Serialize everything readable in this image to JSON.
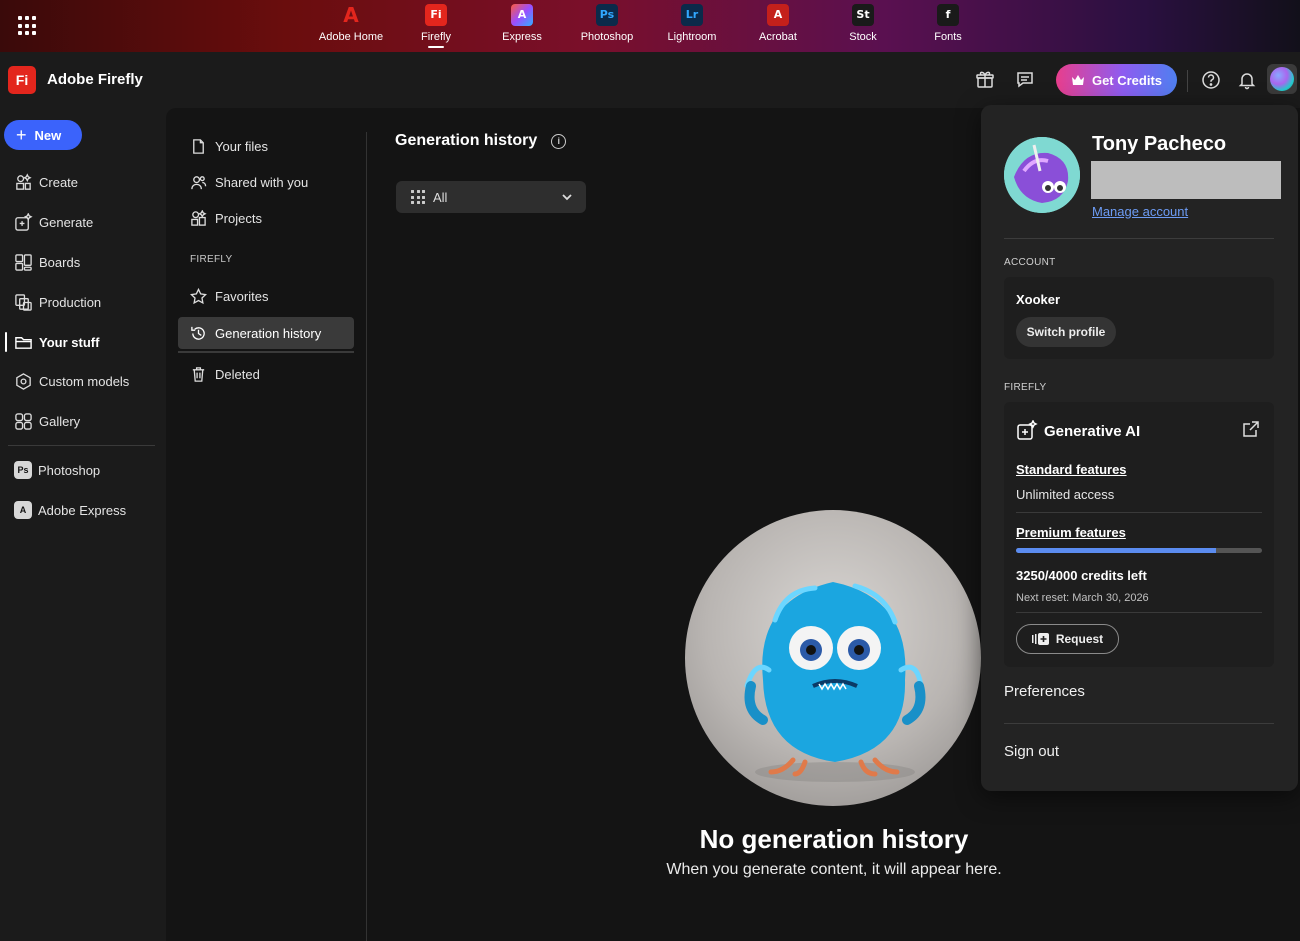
{
  "topbar": {
    "apps": [
      {
        "label": "Adobe Home",
        "icon": "adobe-logo-icon",
        "glyph": "A",
        "color": "#e3261d"
      },
      {
        "label": "Firefly",
        "icon": "firefly-icon",
        "glyph": "Fi",
        "color": "#e3261d"
      },
      {
        "label": "Express",
        "icon": "express-icon",
        "glyph": "A",
        "color": "#1a1a3a"
      },
      {
        "label": "Photoshop",
        "icon": "photoshop-icon",
        "glyph": "Ps",
        "color": "#0b2a4a"
      },
      {
        "label": "Lightroom",
        "icon": "lightroom-icon",
        "glyph": "Lr",
        "color": "#0b2a4a"
      },
      {
        "label": "Acrobat",
        "icon": "acrobat-icon",
        "glyph": "A",
        "color": "#c4201b"
      },
      {
        "label": "Stock",
        "icon": "stock-icon",
        "glyph": "St",
        "color": "#1a1a1a"
      },
      {
        "label": "Fonts",
        "icon": "fonts-icon",
        "glyph": "f",
        "color": "#1a1a1a"
      }
    ]
  },
  "header": {
    "brand": "Adobe Firefly",
    "logo": "Fi",
    "get_credits": "Get Credits",
    "colors": {
      "brand": "#e3261d",
      "accent": "#3b63fb"
    }
  },
  "leftnav": {
    "new_label": "New",
    "items": [
      {
        "label": "Create",
        "icon": "create-icon"
      },
      {
        "label": "Generate",
        "icon": "generate-icon"
      },
      {
        "label": "Boards",
        "icon": "boards-icon"
      },
      {
        "label": "Production",
        "icon": "production-icon"
      },
      {
        "label": "Your stuff",
        "icon": "folder-icon"
      },
      {
        "label": "Custom models",
        "icon": "custom-models-icon"
      },
      {
        "label": "Gallery",
        "icon": "gallery-icon"
      }
    ],
    "apps": [
      {
        "label": "Photoshop",
        "badge": "Ps"
      },
      {
        "label": "Adobe Express",
        "badge": "A"
      }
    ]
  },
  "subnav": {
    "items": [
      {
        "label": "Your files"
      },
      {
        "label": "Shared with you"
      },
      {
        "label": "Projects"
      }
    ],
    "section": "FIREFLY",
    "firefly_items": [
      {
        "label": "Favorites"
      },
      {
        "label": "Generation history"
      },
      {
        "label": "Deleted"
      }
    ]
  },
  "content": {
    "title": "Generation history",
    "filter": "All",
    "empty_title": "No generation history",
    "empty_sub": "When you generate content, it will appear here."
  },
  "profile": {
    "name": "Tony Pacheco",
    "manage": "Manage account",
    "account_section": "ACCOUNT",
    "account_name": "Xooker",
    "switch_profile": "Switch profile",
    "firefly_section": "FIREFLY",
    "gen_ai": "Generative AI",
    "standard": "Standard features",
    "unlimited": "Unlimited access",
    "premium": "Premium features",
    "credits": "3250/4000 credits left",
    "credits_used": 3250,
    "credits_total": 4000,
    "next_reset": "Next reset: March 30, 2026",
    "request": "Request",
    "preferences": "Preferences",
    "sign_out": "Sign out"
  }
}
